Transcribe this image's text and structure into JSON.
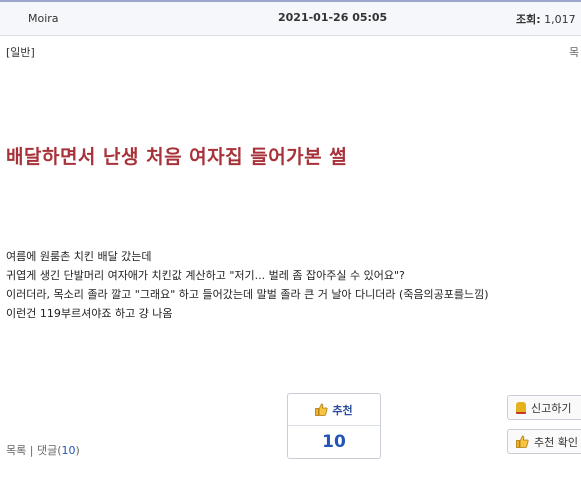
{
  "header": {
    "author": "Moira",
    "date": "2021-01-26 05:05",
    "views_label": "조회:",
    "views_value": "1,017"
  },
  "category": "[일반]",
  "list_top_link": "목",
  "title": "배달하면서 난생 처음 여자집 들어가본 썰",
  "body_lines": [
    "여름에 원룸촌 치킨 배달 갔는데",
    "귀엽게 생긴 단발머리 여자애가 치킨값 계산하고   \"저기... 벌레 좀 잡아주실 수 있어요\"?",
    "이러더라, 목소리 졸라 깔고 \"그래요\" 하고   들어갔는데 말벌 졸라 큰 거 날아 다니더라 (죽음의공포를느낌)",
    "이런건 119부르셔야죠 하고 걍 나옴"
  ],
  "recommend": {
    "label": "추천",
    "count": "10"
  },
  "side_buttons": {
    "report": "신고하기",
    "check_recommend": "추천 확인"
  },
  "footer": {
    "list": "목록",
    "separator": "|",
    "comments_label": "댓글(",
    "comments_count": "10",
    "comments_close": ")"
  },
  "colors": {
    "title": "#a8323a",
    "accent": "#2355b8",
    "header_bg": "#f6f7fb"
  }
}
